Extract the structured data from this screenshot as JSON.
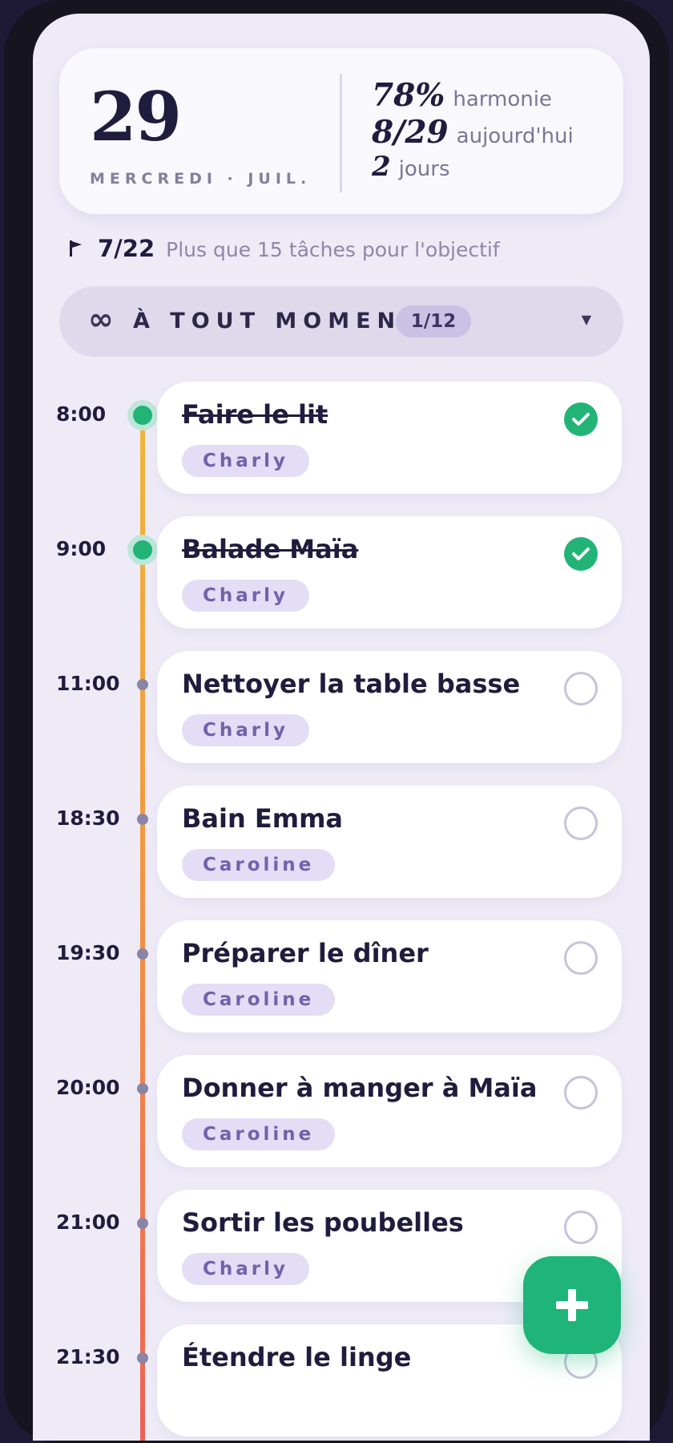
{
  "header": {
    "day_number": "29",
    "day_label": "MERCREDI · JUIL.",
    "stats": [
      {
        "value": "78%",
        "label": "harmonie"
      },
      {
        "value": "8/29",
        "label": "aujourd'hui"
      },
      {
        "value": "2",
        "label": "jours"
      }
    ]
  },
  "goal": {
    "icon": "flag-icon",
    "count": "7/22",
    "text": "Plus que 15 tâches pour l'objectif"
  },
  "anytime": {
    "icon": "infinity-icon",
    "label": "À TOUT MOMENT",
    "badge": "1/12"
  },
  "tasks": [
    {
      "time": "8:00",
      "title": "Faire le lit",
      "assignee": "Charly",
      "done": true
    },
    {
      "time": "9:00",
      "title": "Balade Maïa",
      "assignee": "Charly",
      "done": true
    },
    {
      "time": "11:00",
      "title": "Nettoyer la table basse",
      "assignee": "Charly",
      "done": false
    },
    {
      "time": "18:30",
      "title": "Bain Emma",
      "assignee": "Caroline",
      "done": false
    },
    {
      "time": "19:30",
      "title": "Préparer le dîner",
      "assignee": "Caroline",
      "done": false
    },
    {
      "time": "20:00",
      "title": "Donner à manger à Maïa",
      "assignee": "Caroline",
      "done": false
    },
    {
      "time": "21:00",
      "title": "Sortir les poubelles",
      "assignee": "Charly",
      "done": false
    },
    {
      "time": "21:30",
      "title": "Étendre le linge",
      "assignee": "",
      "done": false
    }
  ],
  "colors": {
    "accent_green": "#1fb47a",
    "timeline_top": "#f0b73a",
    "timeline_bottom": "#ee5f56",
    "tag_bg": "#e3ddf6",
    "text_dark": "#201c3d"
  }
}
